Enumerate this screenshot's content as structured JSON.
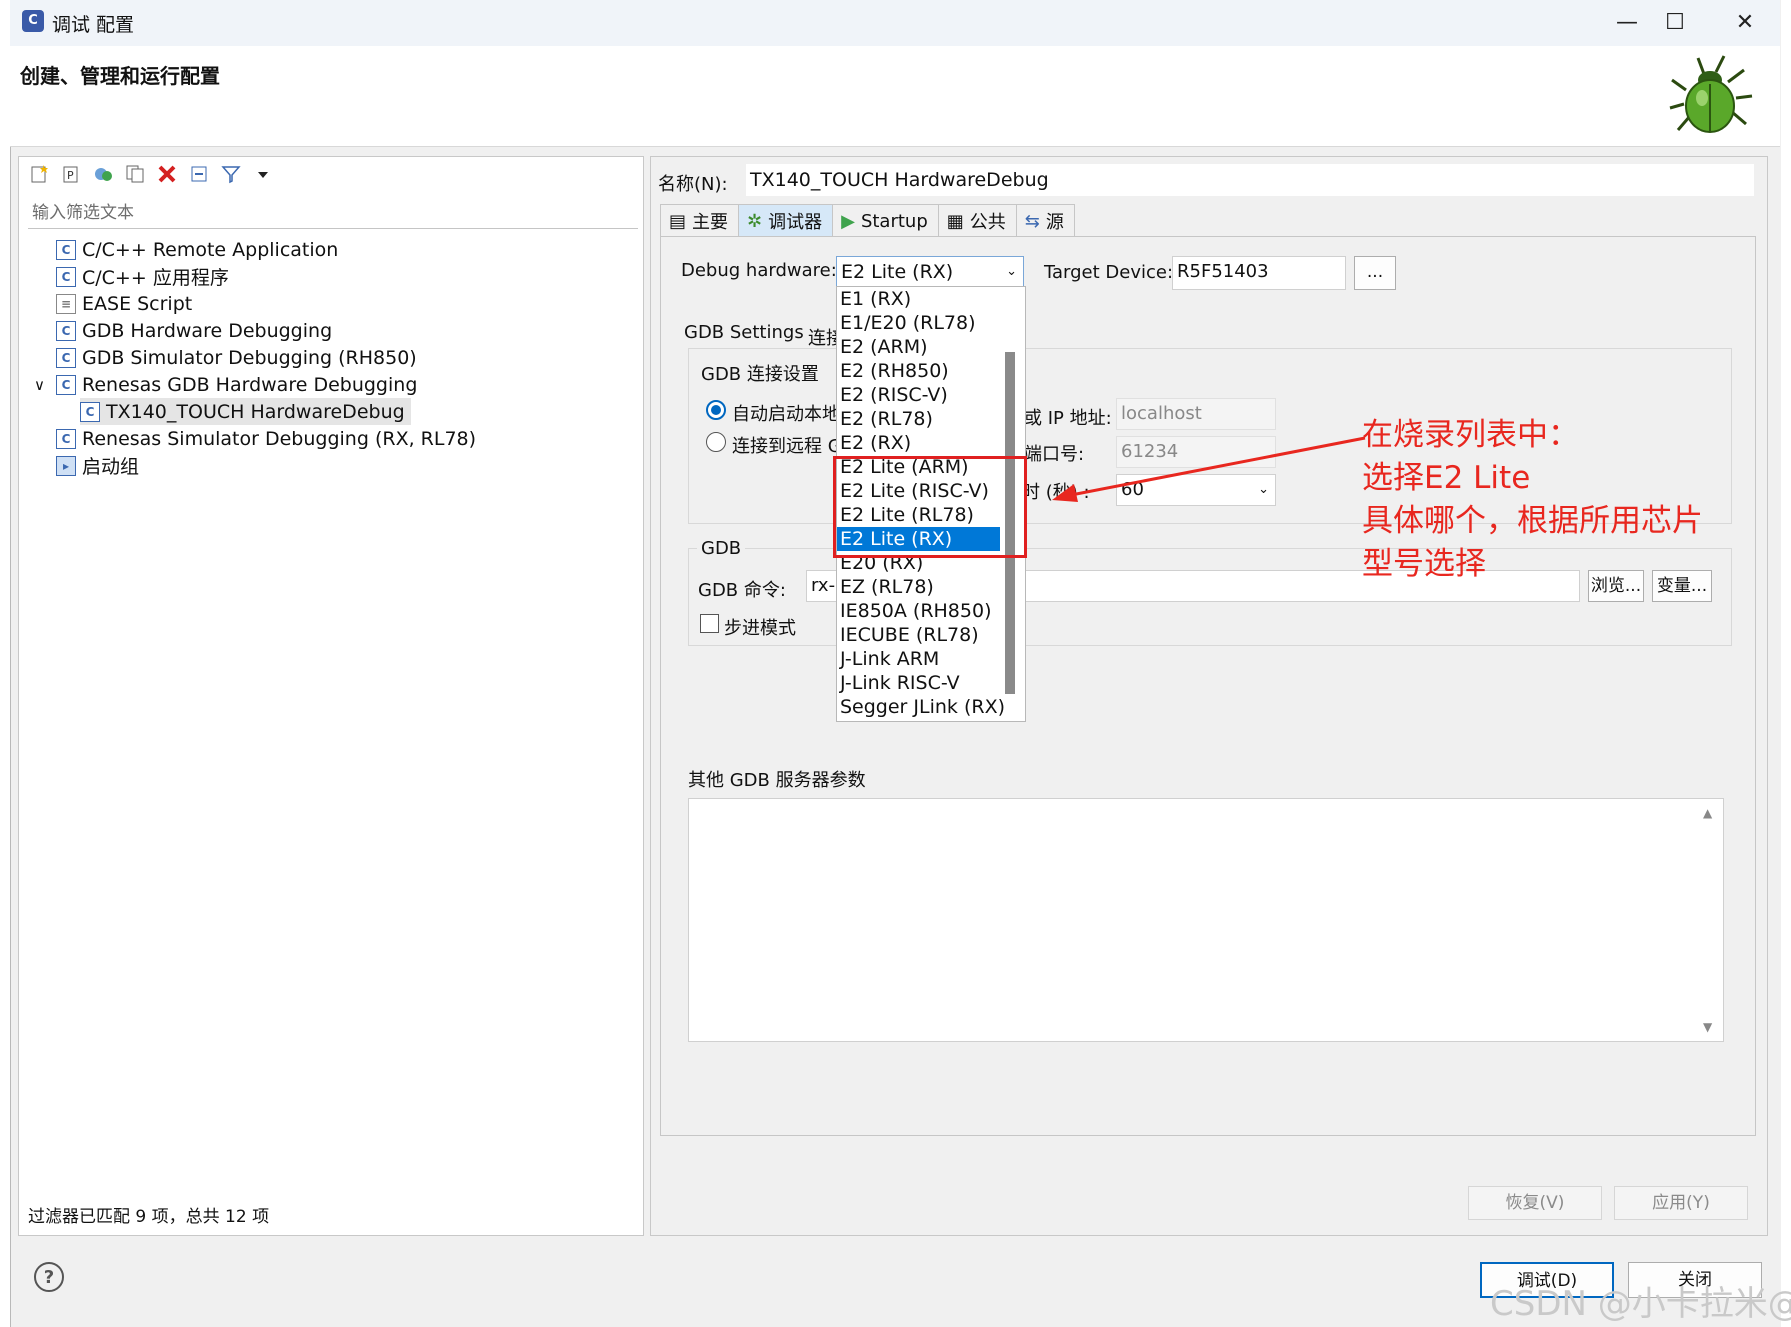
{
  "window": {
    "title": "调试 配置",
    "icon": "debug-app-icon",
    "min_glyph": "—",
    "max_glyph": "☐",
    "close_glyph": "✕"
  },
  "header": {
    "title": "创建、管理和运行配置"
  },
  "left": {
    "filter_placeholder": "输入筛选文本",
    "tree": [
      {
        "label": "C/C++ Remote Application",
        "icon": "c-config-icon"
      },
      {
        "label": "C/C++ 应用程序",
        "icon": "c-config-icon"
      },
      {
        "label": "EASE Script",
        "icon": "script-icon"
      },
      {
        "label": "GDB Hardware Debugging",
        "icon": "c-config-icon"
      },
      {
        "label": "GDB Simulator Debugging (RH850)",
        "icon": "c-config-icon"
      },
      {
        "label": "Renesas GDB Hardware Debugging",
        "icon": "c-config-icon",
        "expander": "∨"
      },
      {
        "label": "TX140_TOUCH HardwareDebug",
        "icon": "c-config-icon"
      },
      {
        "label": "Renesas Simulator Debugging (RX, RL78)",
        "icon": "c-config-icon"
      },
      {
        "label": "启动组",
        "icon": "launch-group-icon"
      }
    ],
    "status": "过滤器已匹配 9 项，总共 12 项"
  },
  "right": {
    "name_label": "名称(N):",
    "name_value": "TX140_TOUCH HardwareDebug",
    "tabs": [
      {
        "label": "主要",
        "icon": "main-tab-icon"
      },
      {
        "label": "调试器",
        "icon": "debugger-tab-icon"
      },
      {
        "label": "Startup",
        "icon": "startup-tab-icon"
      },
      {
        "label": "公共",
        "icon": "common-tab-icon"
      },
      {
        "label": "源",
        "icon": "source-tab-icon"
      }
    ],
    "debug_hw_label": "Debug hardware:",
    "debug_hw_value": "E2 Lite (RX)",
    "target_label": "Target Device:",
    "target_value": "R5F51403",
    "browse_small": "...",
    "sub_tabs": [
      "GDB Settings",
      "连接"
    ],
    "gdb_conn_title": "GDB 连接设置",
    "radio_auto": "自动启动本地",
    "radio_remote": "连接到远程 G",
    "host_label": "或 IP 地址:",
    "host_value": "localhost",
    "port_label": "端口号:",
    "port_value": "61234",
    "timeout_label": "时 (秒) :",
    "timeout_value": "60",
    "gdb_group_title": "GDB",
    "gdb_cmd_label": "GDB 命令:",
    "gdb_cmd_value": "rx-",
    "browse_btn": "浏览...",
    "vars_btn": "变量...",
    "step_mode": "步进模式",
    "other_args_label": "其他 GDB 服务器参数",
    "revert_btn": "恢复(V)",
    "apply_btn": "应用(Y)"
  },
  "dropdown": {
    "items": [
      "E1 (RX)",
      "E1/E20 (RL78)",
      "E2 (ARM)",
      "E2 (RH850)",
      "E2 (RISC-V)",
      "E2 (RL78)",
      "E2 (RX)",
      "E2 Lite (ARM)",
      "E2 Lite (RISC-V)",
      "E2 Lite (RL78)",
      "E2 Lite (RX)",
      "E20 (RX)",
      "EZ (RL78)",
      "IE850A (RH850)",
      "IECUBE (RL78)",
      "J-Link ARM",
      "J-Link RISC-V",
      "Segger JLink (RX)"
    ],
    "selected_index": 10
  },
  "annotation": {
    "lines": [
      "在烧录列表中：",
      "选择E2 Lite",
      "具体哪个，根据所用芯片",
      "型号选择"
    ],
    "color": "#e8271f"
  },
  "footer": {
    "debug_btn": "调试(D)",
    "close_btn": "关闭",
    "watermark": "CSDN @小卡拉米@"
  },
  "colors": {
    "selection": "#0078d7",
    "annotation": "#e8271f",
    "active_tab": "#d6e8f8"
  }
}
